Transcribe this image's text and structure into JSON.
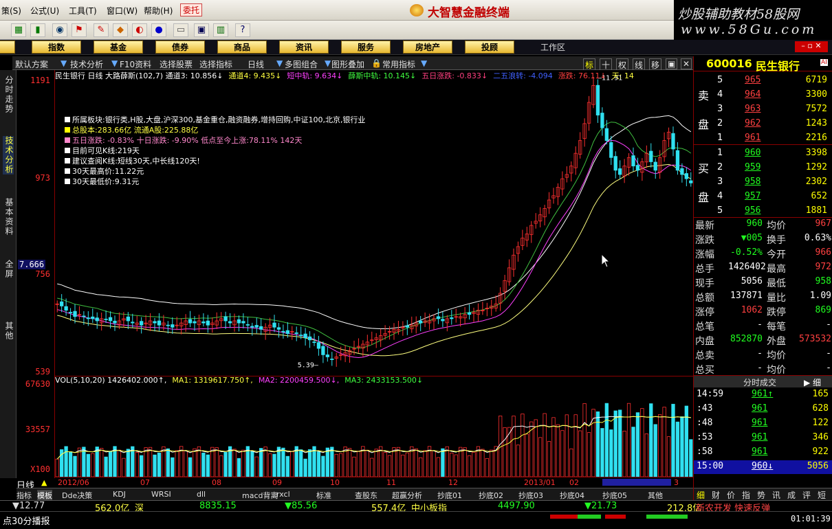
{
  "menu": {
    "items": [
      "策(S)",
      "公式(U)",
      "工具(T)",
      "窗口(W)",
      "帮助(H)",
      "委托"
    ],
    "app_title": "大智慧金融终端",
    "watermark_line1": "炒股辅助教材58股网",
    "watermark_line2": "www.58Gu.com"
  },
  "toolbar": {
    "icons": [
      "layout-icon",
      "bar-icon",
      "binoculars-icon",
      "flag-icon",
      "diamond-icon",
      "eye-icon",
      "drop-icon",
      "note-icon",
      "window-icon",
      "books-icon",
      "help-icon"
    ]
  },
  "nav": {
    "items": [
      "股",
      "指数",
      "基金",
      "债券",
      "商品",
      "资讯",
      "服务",
      "房地产",
      "投顾"
    ],
    "workspace": "工作区"
  },
  "chart_toolbar": {
    "items": [
      "默认方案",
      "技术分析",
      "F10资料",
      "选择股票",
      "选择指标",
      "日线",
      "多图组合",
      "图形叠加",
      "常用指标"
    ],
    "right_buttons": [
      "标",
      "十",
      "权",
      "线",
      "移"
    ]
  },
  "side_tabs": [
    "分时走势",
    "技术分析",
    "基本资料",
    "全屏",
    "其他"
  ],
  "price_axis": {
    "labels": [
      "1191",
      "973",
      "756",
      "539"
    ],
    "cursor": "7.666"
  },
  "volume_axis": {
    "labels": [
      "67630",
      "33557",
      "X100"
    ]
  },
  "indicator_line": [
    {
      "text": "民生银行 日线 大路薛斯(102,7) 通道3: 10.856↓",
      "color": "#ffffff"
    },
    {
      "text": "通道4: 9.435↓",
      "color": "#ffff40"
    },
    {
      "text": "短中轨: 9.634↓",
      "color": "#ff40ff"
    },
    {
      "text": "薛斯中轨: 10.145↓",
      "color": "#40ff40"
    },
    {
      "text": "五日涨跌: -0.833↓",
      "color": "#ff4080"
    },
    {
      "text": "二五浪转: -4.094",
      "color": "#4060ff"
    },
    {
      "text": "涨跌: 76.11↓",
      "color": "#ff4040"
    },
    {
      "text": "天: 14",
      "color": "#ffff40"
    }
  ],
  "info_block": [
    {
      "text": "所属板块:银行类,H股,大盘,沪深300,基金重仓,融资融券,增持回购,中证100,北京,银行业",
      "color": "#ffffff"
    },
    {
      "text": "总股本:283.66亿  流通A股:225.88亿",
      "color": "#ffff40"
    },
    {
      "text": "五日涨跌: -0.83%     十日涨跌: -9.90%  低点至今上涨:78.11%   142天",
      "color": "#ff80c0"
    },
    {
      "text": "目前可见K线:219天",
      "color": "#ffffff"
    },
    {
      "text": "建议查阅K线:短线30天,中长线120天!",
      "color": "#ffffff"
    },
    {
      "text": "30天最高价:11.22元",
      "color": "#ffffff"
    },
    {
      "text": "30天最低价:9.31元",
      "color": "#ffffff"
    }
  ],
  "annotations": {
    "high": "11.91",
    "low": "5.39"
  },
  "vol_line": [
    {
      "text": "VOL(5,10,20) 1426402.000↑,",
      "color": "#ffffff"
    },
    {
      "text": "MA1: 1319617.750↑,",
      "color": "#ffff40"
    },
    {
      "text": "MA2: 2200459.500↓,",
      "color": "#ff40ff"
    },
    {
      "text": "MA3: 2433153.500↓",
      "color": "#40ff40"
    }
  ],
  "date_axis": {
    "period": "日线",
    "labels": [
      "2012/06",
      "07",
      "08",
      "09",
      "10",
      "11",
      "12",
      "2013/01",
      "02",
      "3"
    ]
  },
  "bottom_tabs": [
    "指标",
    "模板",
    "Dde决策",
    "KDJ",
    "WRSI",
    "dll",
    "macd背离",
    "rxcl",
    "标准",
    "查股东",
    "超赢分析",
    "抄底01",
    "抄底02",
    "抄底03",
    "抄底04",
    "抄底05",
    "其他"
  ],
  "ticker": [
    {
      "text": "▼12.77",
      "color": "#20ff20"
    },
    {
      "text": "562.0亿",
      "color": "#ffff40"
    },
    {
      "text": "深",
      "color": "#ffff40"
    },
    {
      "text": "8835.15",
      "color": "#20ff20"
    },
    {
      "text": "▼85.56",
      "color": "#20ff20"
    },
    {
      "text": "557.4亿",
      "color": "#ffff40"
    },
    {
      "text": "中小板指",
      "color": "#ffff40"
    },
    {
      "text": "4497.90",
      "color": "#20ff20"
    },
    {
      "text": "▼21.73",
      "color": "#20ff20"
    },
    {
      "text": "212.8亿",
      "color": "#ffff40"
    },
    {
      "text": "新农开发 快速反弹",
      "color": "#ff4040"
    }
  ],
  "status": {
    "text": "点30分播报",
    "time": "01:01:39"
  },
  "quote": {
    "code": "600016",
    "name": "民生银行",
    "sell_label": [
      "卖",
      "盘"
    ],
    "buy_label": [
      "买",
      "盘"
    ],
    "asks": [
      {
        "lvl": "5",
        "price": "965",
        "vol": "6719",
        "pc": "#ff4040"
      },
      {
        "lvl": "4",
        "price": "964",
        "vol": "3300",
        "pc": "#ff4040"
      },
      {
        "lvl": "3",
        "price": "963",
        "vol": "7572",
        "pc": "#ff4040"
      },
      {
        "lvl": "2",
        "price": "962",
        "vol": "1243",
        "pc": "#ff4040"
      },
      {
        "lvl": "1",
        "price": "961",
        "vol": "2216",
        "pc": "#ff4040"
      }
    ],
    "bids": [
      {
        "lvl": "1",
        "price": "960",
        "vol": "3398",
        "pc": "#20ff20"
      },
      {
        "lvl": "2",
        "price": "959",
        "vol": "1292",
        "pc": "#20ff20"
      },
      {
        "lvl": "3",
        "price": "958",
        "vol": "2302",
        "pc": "#20ff20"
      },
      {
        "lvl": "4",
        "price": "957",
        "vol": "652",
        "pc": "#20ff20"
      },
      {
        "lvl": "5",
        "price": "956",
        "vol": "1881",
        "pc": "#20ff20"
      }
    ],
    "stats": [
      {
        "l": "最新",
        "lv": "960",
        "lc": "#20ff20",
        "r": "均价",
        "rv": "967",
        "rc": "#ff4040"
      },
      {
        "l": "涨跌",
        "lv": "▼005",
        "lc": "#20ff20",
        "r": "换手",
        "rv": "0.63%",
        "rc": "#ffffff"
      },
      {
        "l": "涨幅",
        "lv": "-0.52%",
        "lc": "#20ff20",
        "r": "今开",
        "rv": "966",
        "rc": "#ff4040"
      },
      {
        "l": "总手",
        "lv": "1426402",
        "lc": "#ffffff",
        "r": "最高",
        "rv": "972",
        "rc": "#ff4040"
      },
      {
        "l": "现手",
        "lv": "5056",
        "lc": "#ffffff",
        "r": "最低",
        "rv": "958",
        "rc": "#20ff20"
      },
      {
        "l": "总额",
        "lv": "137871",
        "lc": "#ffffff",
        "r": "量比",
        "rv": "1.09",
        "rc": "#ffffff"
      },
      {
        "l": "涨停",
        "lv": "1062",
        "lc": "#ff4040",
        "r": "跌停",
        "rv": "869",
        "rc": "#20ff20"
      },
      {
        "l": "总笔",
        "lv": "-",
        "lc": "#ffffff",
        "r": "每笔",
        "rv": "-",
        "rc": "#ffffff"
      },
      {
        "l": "内盘",
        "lv": "852870",
        "lc": "#20ff20",
        "r": "外盘",
        "rv": "573532",
        "rc": "#ff4040"
      },
      {
        "l": "总卖",
        "lv": "-",
        "lc": "#ffffff",
        "r": "均价",
        "rv": "-",
        "rc": "#ffffff"
      },
      {
        "l": "总买",
        "lv": "-",
        "lc": "#ffffff",
        "r": "均价",
        "rv": "-",
        "rc": "#ffffff"
      }
    ],
    "ticks_header": "分时成交",
    "ticks_btn": "细",
    "ticks": [
      {
        "t": "14:59",
        "p": "961↑",
        "v": "165"
      },
      {
        "t": ":43",
        "p": "961",
        "v": "628"
      },
      {
        "t": ":48",
        "p": "961",
        "v": "122"
      },
      {
        "t": ":53",
        "p": "961",
        "v": "346"
      },
      {
        "t": ":58",
        "p": "961",
        "v": "922"
      },
      {
        "t": "15:00",
        "p": "960↓",
        "v": "5056"
      }
    ],
    "bottom_tabs": [
      "细",
      "财",
      "价",
      "指",
      "势",
      "讯",
      "成",
      "评",
      "短"
    ]
  },
  "chart_data": {
    "type": "candlestick",
    "series_note": "daily closes (approx, CNY)",
    "closes": [
      6.75,
      6.7,
      6.6,
      6.55,
      6.45,
      6.5,
      6.45,
      6.4,
      6.4,
      6.35,
      6.4,
      6.38,
      6.35,
      6.3,
      6.35,
      6.4,
      6.35,
      6.3,
      6.3,
      6.25,
      6.3,
      6.35,
      6.3,
      6.25,
      6.3,
      6.25,
      6.2,
      6.25,
      6.3,
      6.35,
      6.3,
      6.3,
      6.35,
      6.3,
      6.25,
      6.3,
      6.35,
      6.4,
      6.35,
      6.3,
      6.35,
      6.3,
      6.3,
      6.25,
      6.2,
      6.2,
      6.15,
      6.2,
      6.25,
      6.2,
      6.15,
      6.1,
      6.05,
      6.1,
      6.05,
      6.0,
      5.95,
      5.9,
      5.85,
      5.7,
      5.55,
      5.5,
      5.45,
      5.5,
      5.55,
      5.6,
      5.65,
      5.7,
      5.75,
      5.8,
      5.85,
      5.9,
      5.95,
      6.0,
      6.05,
      6.1,
      6.15,
      6.15,
      6.2,
      6.2,
      6.25,
      6.3,
      6.3,
      6.35,
      6.35,
      6.4,
      6.4,
      6.35,
      6.4,
      6.4,
      6.45,
      6.45,
      6.5,
      6.5,
      6.55,
      6.6,
      6.6,
      6.65,
      6.7,
      6.75,
      7.0,
      7.3,
      7.6,
      7.9,
      8.1,
      8.3,
      8.4,
      8.6,
      8.7,
      8.85,
      9.0,
      9.2,
      9.3,
      9.5,
      9.7,
      9.8,
      10.0,
      10.3,
      10.6,
      11.0,
      11.5,
      11.9,
      11.2,
      10.9,
      10.6,
      10.2,
      9.9,
      9.8,
      10.0,
      10.2,
      10.0,
      9.9,
      10.1,
      10.3,
      10.1,
      9.9,
      10.2,
      10.6,
      10.8,
      10.4,
      9.9,
      9.8,
      9.7,
      9.6
    ]
  }
}
